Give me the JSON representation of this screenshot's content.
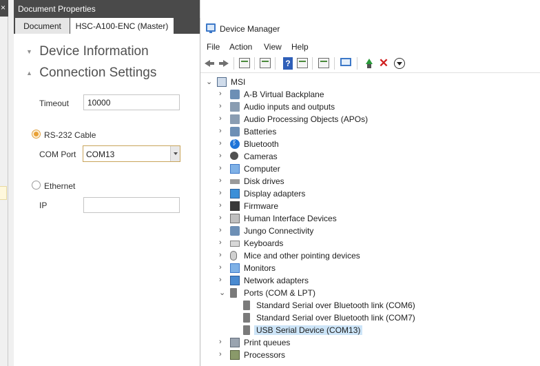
{
  "doc_properties": {
    "title": "Document Properties",
    "tabs": [
      "Document",
      "HSC-A100-ENC (Master)"
    ],
    "sections": [
      "Device Information",
      "Connection Settings"
    ],
    "timeout_label": "Timeout",
    "timeout_value": "10000",
    "rs232_label": "RS-232 Cable",
    "com_port_label": "COM Port",
    "com_port_value": "COM13",
    "ethernet_label": "Ethernet",
    "ip_label": "IP",
    "ip_value": ""
  },
  "device_manager": {
    "title": "Device Manager",
    "menu": [
      "File",
      "Action",
      "View",
      "Help"
    ],
    "toolbar_icons": [
      "back-icon",
      "forward-icon",
      "properties-icon",
      "update-icon",
      "help-icon",
      "view-icon",
      "scan-icon",
      "monitor-icon",
      "add-driver-icon",
      "uninstall-icon",
      "disable-icon"
    ],
    "root": "MSI",
    "categories": [
      {
        "label": "A-B Virtual Backplane",
        "icon": "generic-device-icon"
      },
      {
        "label": "Audio inputs and outputs",
        "icon": "audio-icon"
      },
      {
        "label": "Audio Processing Objects (APOs)",
        "icon": "audio-icon"
      },
      {
        "label": "Batteries",
        "icon": "battery-icon"
      },
      {
        "label": "Bluetooth",
        "icon": "bluetooth-icon"
      },
      {
        "label": "Cameras",
        "icon": "camera-icon"
      },
      {
        "label": "Computer",
        "icon": "computer-icon"
      },
      {
        "label": "Disk drives",
        "icon": "disk-icon"
      },
      {
        "label": "Display adapters",
        "icon": "display-adapter-icon"
      },
      {
        "label": "Firmware",
        "icon": "firmware-icon"
      },
      {
        "label": "Human Interface Devices",
        "icon": "hid-icon"
      },
      {
        "label": "Jungo Connectivity",
        "icon": "generic-device-icon"
      },
      {
        "label": "Keyboards",
        "icon": "keyboard-icon"
      },
      {
        "label": "Mice and other pointing devices",
        "icon": "mouse-icon"
      },
      {
        "label": "Monitors",
        "icon": "monitor-icon"
      },
      {
        "label": "Network adapters",
        "icon": "network-icon"
      },
      {
        "label": "Ports (COM & LPT)",
        "icon": "port-icon"
      }
    ],
    "ports_children": [
      "Standard Serial over Bluetooth link (COM6)",
      "Standard Serial over Bluetooth link (COM7)",
      "USB Serial Device (COM13)"
    ],
    "after_categories": [
      {
        "label": "Print queues",
        "icon": "printer-icon"
      },
      {
        "label": "Processors",
        "icon": "processor-icon"
      }
    ]
  },
  "colors": {
    "selection": "#cce4f7",
    "titlebar_dark": "#4a4a4a",
    "radio_accent": "#e8a035"
  }
}
